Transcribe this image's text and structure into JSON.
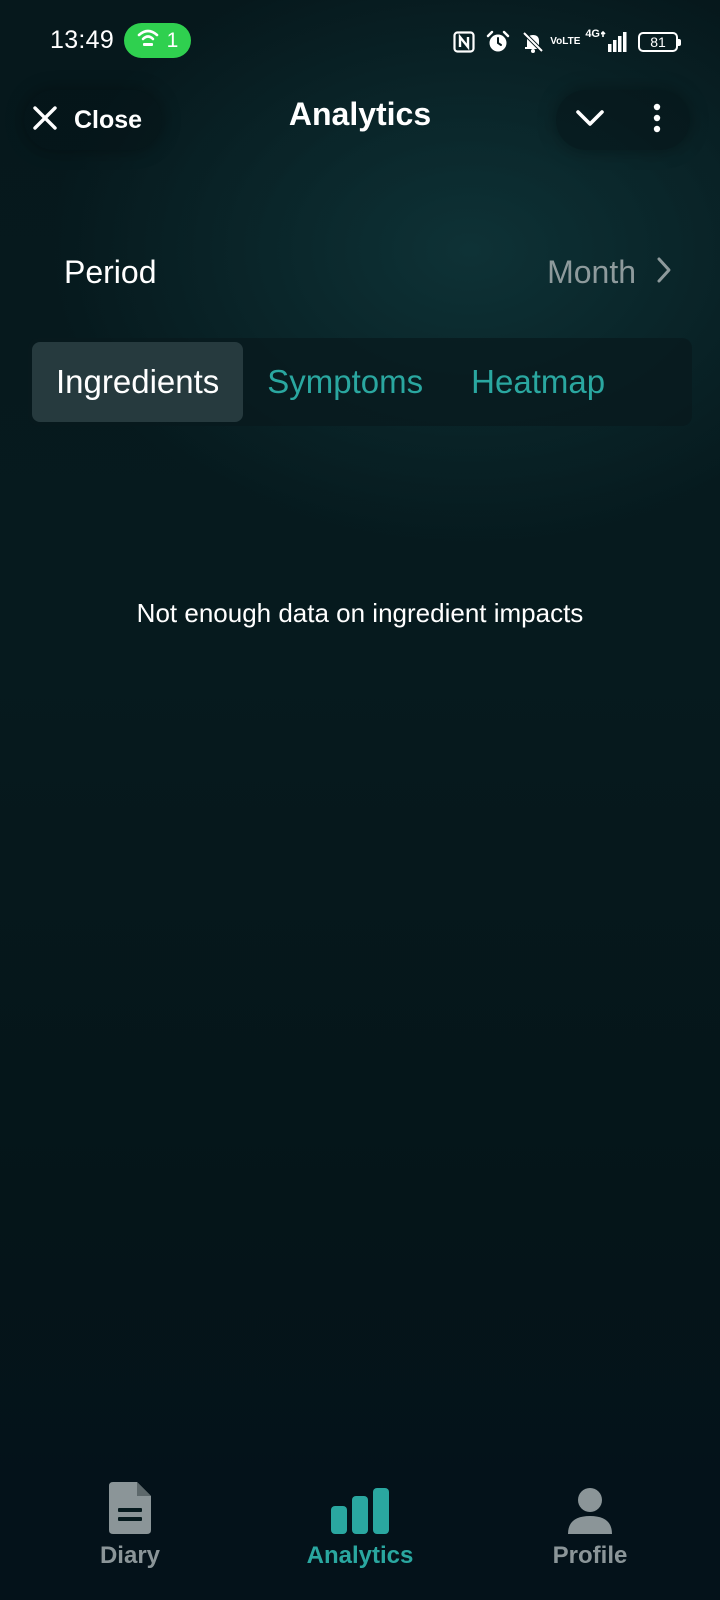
{
  "status_bar": {
    "time": "13:49",
    "hotspot_count": "1",
    "volte_top": "Vo",
    "volte_bottom": "LTE",
    "network_label": "4G",
    "battery_level": "81"
  },
  "app_bar": {
    "close_label": "Close",
    "title": "Analytics"
  },
  "period": {
    "label": "Period",
    "value": "Month"
  },
  "tabs": [
    {
      "label": "Ingredients",
      "active": true
    },
    {
      "label": "Symptoms",
      "active": false
    },
    {
      "label": "Heatmap",
      "active": false
    }
  ],
  "content": {
    "empty_message": "Not enough data on ingredient impacts"
  },
  "bottom_nav": {
    "items": [
      {
        "label": "Diary",
        "icon": "document-icon",
        "active": false
      },
      {
        "label": "Analytics",
        "icon": "bar-chart-icon",
        "active": true
      },
      {
        "label": "Profile",
        "icon": "person-icon",
        "active": false
      }
    ]
  },
  "colors": {
    "accent": "#2aa7a0",
    "background": "#061a1e",
    "hotspot_pill": "#2fd04f",
    "inactive": "#8b9598"
  }
}
